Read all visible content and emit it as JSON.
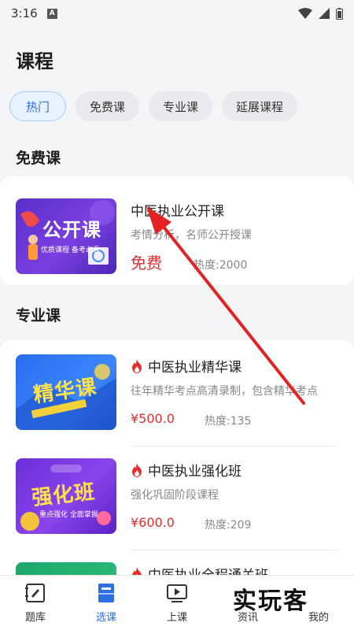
{
  "status": {
    "time": "3:16",
    "badge": "A"
  },
  "page": {
    "title": "课程"
  },
  "tabs": [
    {
      "label": "热门",
      "active": true
    },
    {
      "label": "免费课",
      "active": false
    },
    {
      "label": "专业课",
      "active": false
    },
    {
      "label": "延展课程",
      "active": false
    }
  ],
  "free_section": {
    "title": "免费课",
    "course": {
      "name": "中医执业公开课",
      "desc": "考情分析，名师公开授课",
      "price": "免费",
      "heat": "热度:2000",
      "thumb_title": "公开课",
      "thumb_sub": "优质课程 备考必看"
    }
  },
  "pro_section": {
    "title": "专业课",
    "courses": [
      {
        "name": "中医执业精华课",
        "desc": "往年精华考点高清录制，包含精华考点",
        "price": "¥500.0",
        "heat": "热度:135",
        "thumb_title": "精华课"
      },
      {
        "name": "中医执业强化班",
        "desc": "强化巩固阶段课程",
        "price": "¥600.0",
        "heat": "热度:209",
        "thumb_title": "强化班",
        "thumb_sub": "重点强化 全面掌握"
      },
      {
        "name": "中医执业全程通关班"
      }
    ]
  },
  "nav": [
    {
      "label": "题库",
      "active": false
    },
    {
      "label": "选课",
      "active": true
    },
    {
      "label": "上课",
      "active": false
    },
    {
      "label": "资讯",
      "active": false
    },
    {
      "label": "我的",
      "active": false
    }
  ],
  "watermark": "实玩客",
  "colors": {
    "accent": "#2c6fe0",
    "price": "#e02e2e",
    "arrow": "#e32222"
  }
}
